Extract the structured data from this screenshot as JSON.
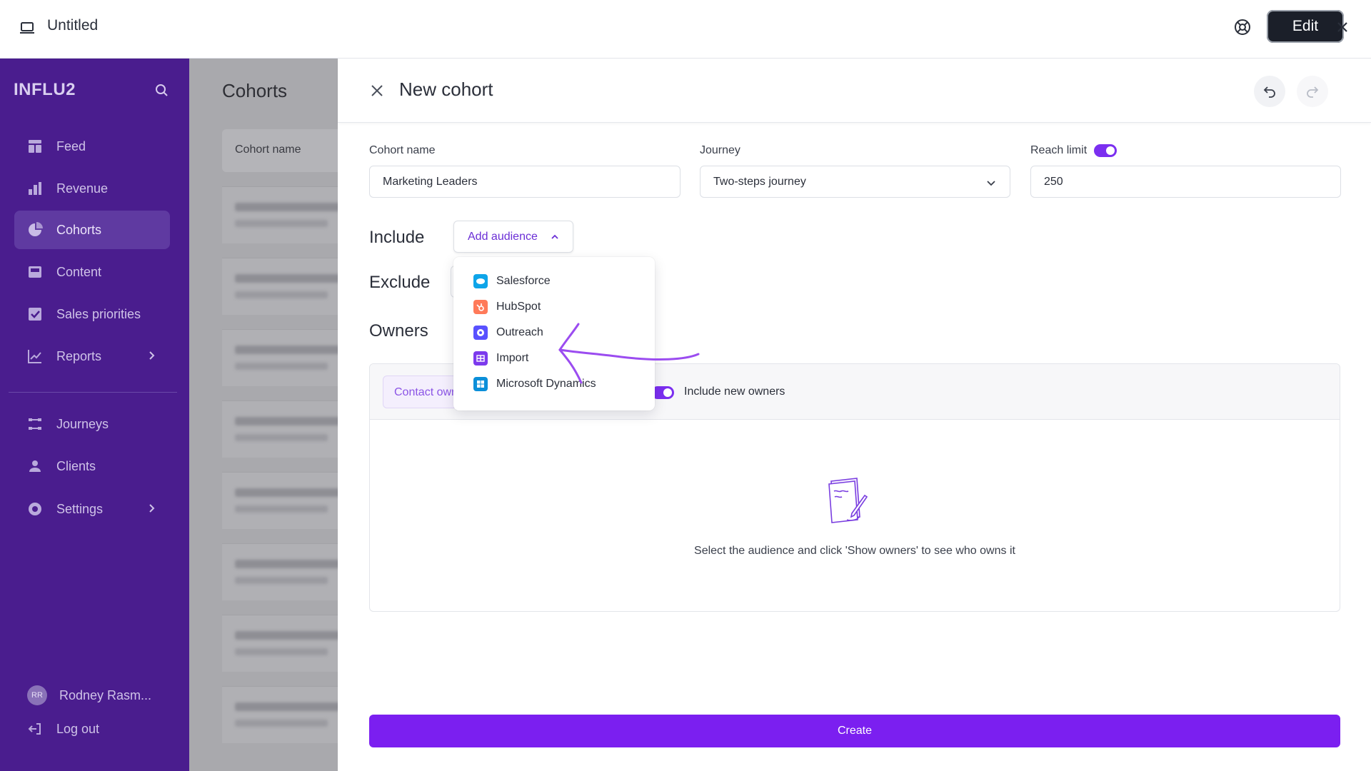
{
  "window": {
    "title": "Untitled",
    "edit_label": "Edit"
  },
  "sidebar": {
    "brand": "INFLU2",
    "items": [
      {
        "label": "Feed",
        "icon": "feed-icon"
      },
      {
        "label": "Revenue",
        "icon": "bar-chart-icon"
      },
      {
        "label": "Cohorts",
        "icon": "pie-chart-icon",
        "active": true
      },
      {
        "label": "Content",
        "icon": "content-icon"
      },
      {
        "label": "Sales priorities",
        "icon": "checkbox-icon"
      },
      {
        "label": "Reports",
        "icon": "line-chart-icon",
        "has_submenu": true
      },
      {
        "label": "Journeys",
        "icon": "journeys-icon"
      },
      {
        "label": "Clients",
        "icon": "clients-icon"
      },
      {
        "label": "Settings",
        "icon": "settings-icon",
        "has_submenu": true
      }
    ],
    "user": {
      "initials": "RR",
      "name": "Rodney Rasm..."
    },
    "logout_label": "Log out"
  },
  "background_page": {
    "title": "Cohorts",
    "column_header": "Cohort name"
  },
  "drawer": {
    "title": "New cohort",
    "cohort_name": {
      "label": "Cohort name",
      "value": "Marketing Leaders"
    },
    "journey": {
      "label": "Journey",
      "value": "Two-steps journey"
    },
    "reach_limit": {
      "label": "Reach limit",
      "value": "250",
      "enabled": true
    },
    "include_label": "Include",
    "add_audience_label": "Add audience",
    "exclude_label": "Exclude",
    "owners_label": "Owners",
    "contact_owner_tab": "Contact owner",
    "include_new_owners": {
      "label": "Include new owners",
      "enabled": true
    },
    "empty_message": "Select the audience and click 'Show owners' to see who owns it",
    "create_label": "Create"
  },
  "audience_dropdown": {
    "options": [
      {
        "label": "Salesforce",
        "icon": "salesforce-icon",
        "color": "#0ea5e9"
      },
      {
        "label": "HubSpot",
        "icon": "hubspot-icon",
        "color": "#ff7a59"
      },
      {
        "label": "Outreach",
        "icon": "outreach-icon",
        "color": "#5951ff"
      },
      {
        "label": "Import",
        "icon": "import-icon",
        "color": "#7c3aed"
      },
      {
        "label": "Microsoft Dynamics",
        "icon": "microsoft-dynamics-icon",
        "color": "#0b8fd9"
      }
    ]
  },
  "colors": {
    "sidebar": "#4a1d8e",
    "accent": "#7b1ff0",
    "annotation_arrow": "#9b4cf0"
  }
}
